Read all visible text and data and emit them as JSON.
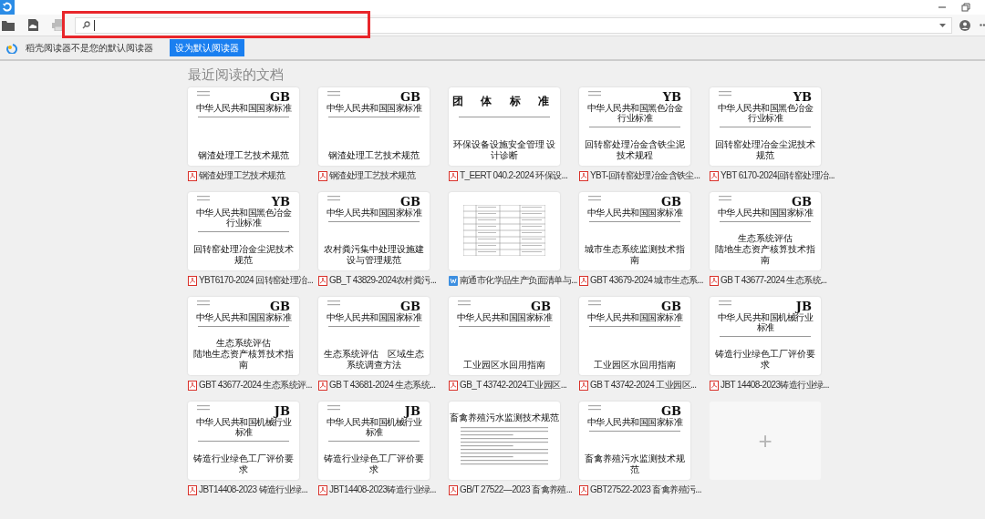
{
  "toolbar": {
    "search": {
      "highlighted": true
    }
  },
  "notice": {
    "text": "稻壳阅读器不是您的默认阅读器",
    "button": "设为默认阅读器"
  },
  "section_title": "最近阅读的文档",
  "documents": [
    {
      "kind": "pdf",
      "caption": "钢渣处理工艺技术规范",
      "page": {
        "kind": "standard",
        "mark": "GB",
        "header": "中华人民共和国国家标准",
        "title": [
          "钢渣处理工艺技术规范"
        ]
      }
    },
    {
      "kind": "pdf",
      "caption": "钢渣处理工艺技术规范",
      "page": {
        "kind": "standard",
        "mark": "GB",
        "header": "中华人民共和国国家标准",
        "title": [
          "钢渣处理工艺技术规范"
        ]
      }
    },
    {
      "kind": "pdf",
      "caption": "T_EERT 040.2-2024 环保设...",
      "page": {
        "kind": "group",
        "header": "团 体 标 准",
        "title": [
          "环保设备设施安全管理 设计诊断"
        ]
      }
    },
    {
      "kind": "pdf",
      "caption": "YBT-回转窑处理冶金含铁尘...",
      "page": {
        "kind": "standard",
        "mark": "YB",
        "header": "中华人民共和国黑色冶金行业标准",
        "title": [
          "回转窑处理冶金含铁尘泥技术规程"
        ]
      }
    },
    {
      "kind": "pdf",
      "caption": "YBT 6170-2024回转窑处理冶...",
      "page": {
        "kind": "standard",
        "mark": "YB",
        "header": "中华人民共和国黑色冶金行业标准",
        "title": [
          "回转窑处理冶金尘泥技术规范"
        ]
      }
    },
    {
      "kind": "pdf",
      "caption": "YBT6170-2024 回转窑处理冶...",
      "page": {
        "kind": "standard",
        "mark": "YB",
        "header": "中华人民共和国黑色冶金行业标准",
        "title": [
          "回转窑处理冶金尘泥技术规范"
        ]
      }
    },
    {
      "kind": "pdf",
      "caption": "GB_T 43829-2024农村粪污...",
      "page": {
        "kind": "standard",
        "mark": "GB",
        "header": "中华人民共和国国家标准",
        "title": [
          "农村粪污集中处理设施建设与管理规范"
        ]
      }
    },
    {
      "kind": "word",
      "caption": "南通市化学品生产负面清单与...",
      "page": {
        "kind": "table"
      }
    },
    {
      "kind": "pdf",
      "caption": "GBT 43679-2024 城市生态系...",
      "page": {
        "kind": "standard",
        "mark": "GB",
        "header": "中华人民共和国国家标准",
        "title": [
          "城市生态系统监测技术指南"
        ]
      }
    },
    {
      "kind": "pdf",
      "caption": "GB T 43677-2024 生态系统...",
      "page": {
        "kind": "standard",
        "mark": "GB",
        "header": "中华人民共和国国家标准",
        "title": [
          "生态系统评估",
          "陆地生态资产核算技术指南"
        ]
      }
    },
    {
      "kind": "pdf",
      "caption": "GBT 43677-2024 生态系统评...",
      "page": {
        "kind": "standard",
        "mark": "GB",
        "header": "中华人民共和国国家标准",
        "title": [
          "生态系统评估",
          "陆地生态资产核算技术指南"
        ]
      }
    },
    {
      "kind": "pdf",
      "caption": "GB T 43681-2024 生态系统...",
      "page": {
        "kind": "standard",
        "mark": "GB",
        "header": "中华人民共和国国家标准",
        "title": [
          "生态系统评估　区域生态系统调查方法"
        ]
      }
    },
    {
      "kind": "pdf",
      "caption": "GB_T 43742-2024工业园区...",
      "page": {
        "kind": "standard",
        "mark": "GB",
        "header": "中华人民共和国国家标准",
        "title": [
          "工业园区水回用指南"
        ]
      }
    },
    {
      "kind": "pdf",
      "caption": "GB T 43742-2024 工业园区...",
      "page": {
        "kind": "standard",
        "mark": "GB",
        "header": "中华人民共和国国家标准",
        "title": [
          "工业园区水回用指南"
        ]
      }
    },
    {
      "kind": "pdf",
      "caption": "JBT 14408-2023铸造行业绿...",
      "page": {
        "kind": "standard",
        "mark": "JB",
        "header": "中华人民共和国机械行业标准",
        "title": [
          "铸造行业绿色工厂评价要求"
        ]
      }
    },
    {
      "kind": "pdf",
      "caption": "JBT14408-2023 铸造行业绿...",
      "page": {
        "kind": "standard",
        "mark": "JB",
        "header": "中华人民共和国机械行业标准",
        "title": [
          "铸造行业绿色工厂评价要求"
        ]
      }
    },
    {
      "kind": "pdf",
      "caption": "JBT14408-2023铸造行业绿...",
      "page": {
        "kind": "standard",
        "mark": "JB",
        "header": "中华人民共和国机械行业标准",
        "title": [
          "铸造行业绿色工厂评价要求"
        ]
      }
    },
    {
      "kind": "pdf",
      "caption": "GB/T 27522—2023 畜禽养殖...",
      "page": {
        "kind": "text",
        "title": [
          "畜禽养殖污水监测技术规范"
        ]
      }
    },
    {
      "kind": "pdf",
      "caption": "GBT27522-2023 畜禽养殖污...",
      "page": {
        "kind": "standard",
        "mark": "GB",
        "header": "中华人民共和国国家标准",
        "title": [
          "畜禽养殖污水监测技术规范"
        ]
      }
    }
  ],
  "add_tile": {
    "symbol": "+"
  }
}
